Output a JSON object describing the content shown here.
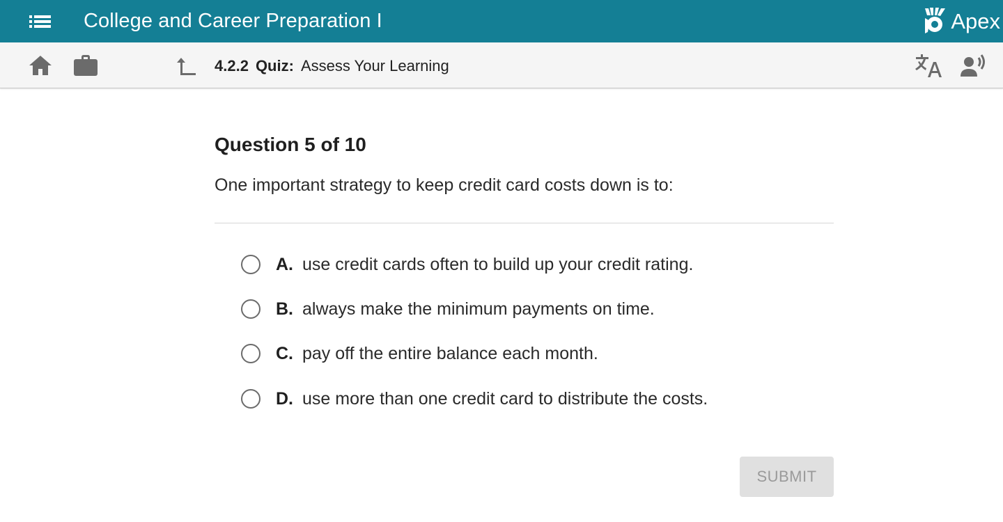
{
  "topbar": {
    "menu_icon": "list-menu-icon",
    "course_title": "College and Career Preparation I",
    "brand_logo_icon": "apex-logo-icon",
    "brand_name": "Apex",
    "bg_color": "#147f95"
  },
  "navbar": {
    "home_icon": "home-icon",
    "briefcase_icon": "briefcase-icon",
    "up_icon": "return-up-arrow-icon",
    "activity_number": "4.2.2",
    "activity_type": "Quiz:",
    "activity_title": "Assess Your Learning",
    "translate_icon": "translate-icon",
    "read_aloud_icon": "read-aloud-icon"
  },
  "question": {
    "heading": "Question 5 of 10",
    "prompt": "One important strategy to keep credit card costs down is to:",
    "options": [
      {
        "letter": "A.",
        "text": "use credit cards often to build up your credit rating.",
        "selected": false
      },
      {
        "letter": "B.",
        "text": "always make the minimum payments on time.",
        "selected": false
      },
      {
        "letter": "C.",
        "text": "pay off the entire balance each month.",
        "selected": false
      },
      {
        "letter": "D.",
        "text": "use more than one credit card to distribute the costs.",
        "selected": false
      }
    ]
  },
  "submit": {
    "label": "SUBMIT",
    "enabled": false
  }
}
